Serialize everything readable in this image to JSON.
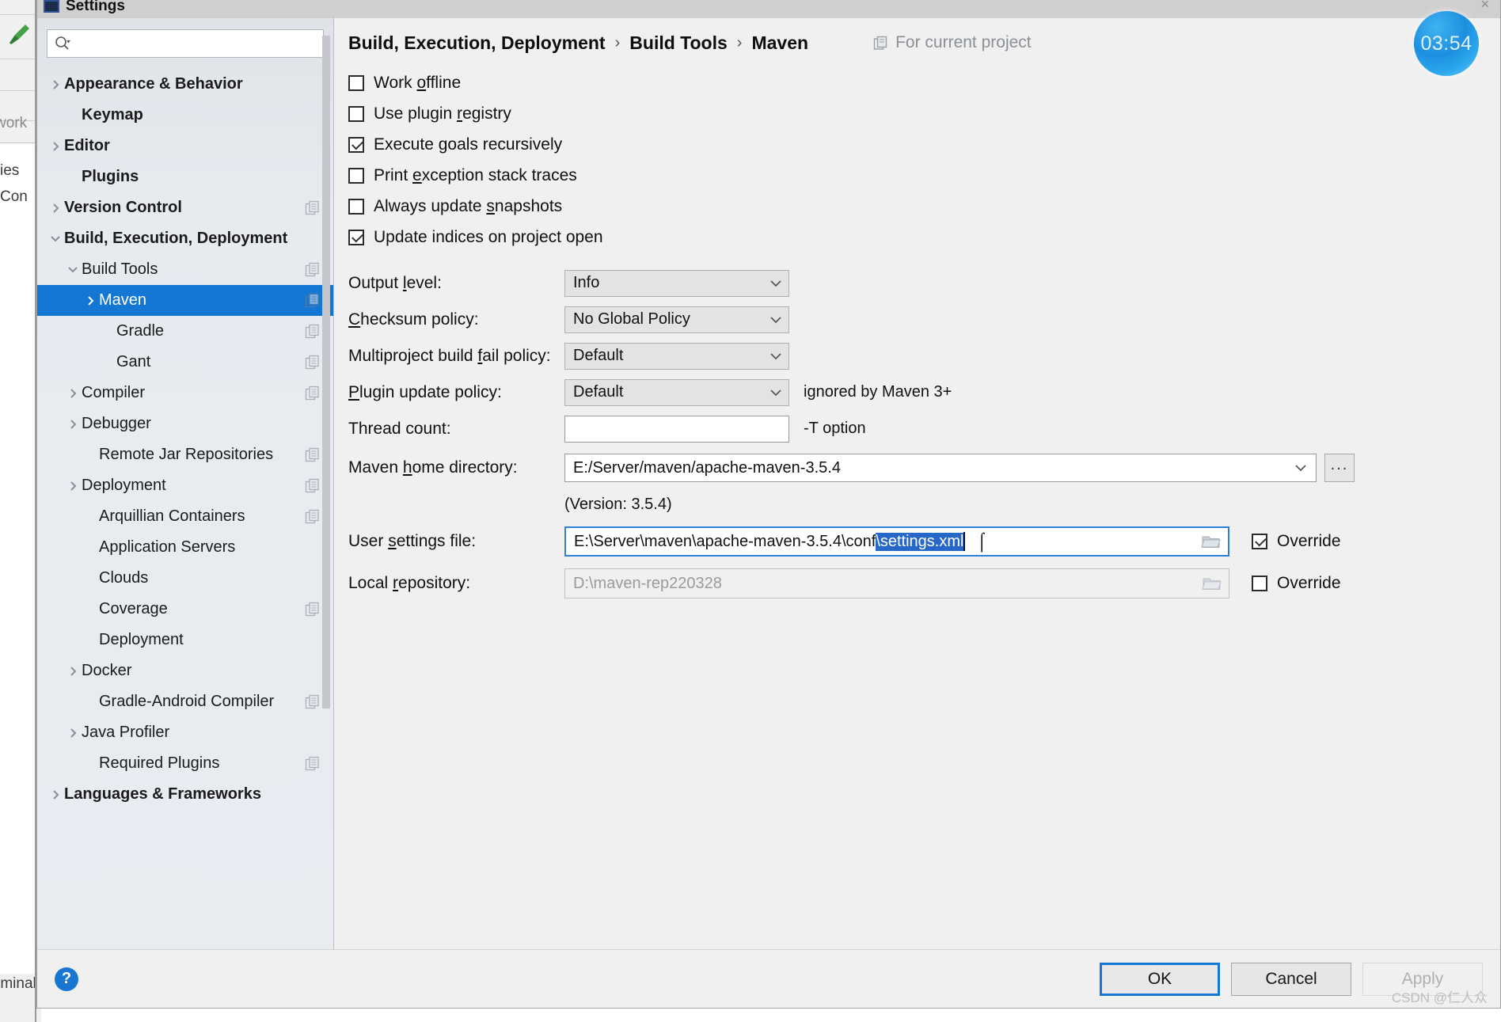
{
  "window": {
    "title": "Settings",
    "close_label": "×",
    "app_icon": "settings-window-icon"
  },
  "background": {
    "hammer_icon": "maven-hammer-icon",
    "text_fragments": [
      "work",
      "ies",
      "Con",
      "rminal"
    ]
  },
  "clock_widget": {
    "time": "03:54"
  },
  "search": {
    "value": "",
    "placeholder": "",
    "icon": "search-icon"
  },
  "sidebar": {
    "items": [
      {
        "label": "Appearance & Behavior",
        "indent": 0,
        "arrow": "right",
        "bold": true,
        "badge": false,
        "selected": false
      },
      {
        "label": "Keymap",
        "indent": 1,
        "arrow": "none",
        "bold": true,
        "badge": false,
        "selected": false
      },
      {
        "label": "Editor",
        "indent": 0,
        "arrow": "right",
        "bold": true,
        "badge": false,
        "selected": false
      },
      {
        "label": "Plugins",
        "indent": 1,
        "arrow": "none",
        "bold": true,
        "badge": false,
        "selected": false
      },
      {
        "label": "Version Control",
        "indent": 0,
        "arrow": "right",
        "bold": true,
        "badge": true,
        "selected": false
      },
      {
        "label": "Build, Execution, Deployment",
        "indent": 0,
        "arrow": "down",
        "bold": true,
        "badge": false,
        "selected": false
      },
      {
        "label": "Build Tools",
        "indent": 1,
        "arrow": "down",
        "bold": false,
        "badge": true,
        "selected": false
      },
      {
        "label": "Maven",
        "indent": 2,
        "arrow": "right",
        "bold": false,
        "badge": true,
        "selected": true
      },
      {
        "label": "Gradle",
        "indent": 3,
        "arrow": "none",
        "bold": false,
        "badge": true,
        "selected": false
      },
      {
        "label": "Gant",
        "indent": 3,
        "arrow": "none",
        "bold": false,
        "badge": true,
        "selected": false
      },
      {
        "label": "Compiler",
        "indent": 1,
        "arrow": "right",
        "bold": false,
        "badge": true,
        "selected": false
      },
      {
        "label": "Debugger",
        "indent": 1,
        "arrow": "right",
        "bold": false,
        "badge": false,
        "selected": false
      },
      {
        "label": "Remote Jar Repositories",
        "indent": 2,
        "arrow": "none",
        "bold": false,
        "badge": true,
        "selected": false
      },
      {
        "label": "Deployment",
        "indent": 1,
        "arrow": "right",
        "bold": false,
        "badge": true,
        "selected": false
      },
      {
        "label": "Arquillian Containers",
        "indent": 2,
        "arrow": "none",
        "bold": false,
        "badge": true,
        "selected": false
      },
      {
        "label": "Application Servers",
        "indent": 2,
        "arrow": "none",
        "bold": false,
        "badge": false,
        "selected": false
      },
      {
        "label": "Clouds",
        "indent": 2,
        "arrow": "none",
        "bold": false,
        "badge": false,
        "selected": false
      },
      {
        "label": "Coverage",
        "indent": 2,
        "arrow": "none",
        "bold": false,
        "badge": true,
        "selected": false
      },
      {
        "label": "Deployment",
        "indent": 2,
        "arrow": "none",
        "bold": false,
        "badge": false,
        "selected": false
      },
      {
        "label": "Docker",
        "indent": 1,
        "arrow": "right",
        "bold": false,
        "badge": false,
        "selected": false
      },
      {
        "label": "Gradle-Android Compiler",
        "indent": 2,
        "arrow": "none",
        "bold": false,
        "badge": true,
        "selected": false
      },
      {
        "label": "Java Profiler",
        "indent": 1,
        "arrow": "right",
        "bold": false,
        "badge": false,
        "selected": false
      },
      {
        "label": "Required Plugins",
        "indent": 2,
        "arrow": "none",
        "bold": false,
        "badge": true,
        "selected": false
      },
      {
        "label": "Languages & Frameworks",
        "indent": 0,
        "arrow": "right",
        "bold": true,
        "badge": false,
        "selected": false
      }
    ]
  },
  "breadcrumb": {
    "parts": [
      "Build, Execution, Deployment",
      "Build Tools",
      "Maven"
    ],
    "separator": "›",
    "scope_label": "For current project",
    "scope_icon": "project-scope-icon"
  },
  "main": {
    "checkboxes": [
      {
        "pre": "Work ",
        "mnemonic": "o",
        "post": "ffline",
        "checked": false
      },
      {
        "pre": "Use plugin ",
        "mnemonic": "r",
        "post": "egistry",
        "checked": false
      },
      {
        "pre": "Execute ",
        "mnemonic": "g",
        "post": "oals recursively",
        "checked": true
      },
      {
        "pre": "Print ",
        "mnemonic": "e",
        "post": "xception stack traces",
        "checked": false
      },
      {
        "pre": "Always update ",
        "mnemonic": "s",
        "post": "napshots",
        "checked": false
      },
      {
        "pre": "Update indices on project open",
        "mnemonic": "",
        "post": "",
        "checked": true
      }
    ],
    "fields": {
      "output_level": {
        "pre": "Output ",
        "mnemonic": "l",
        "post": "evel:",
        "value": "Info"
      },
      "checksum_policy": {
        "pre": "",
        "mnemonic": "C",
        "post": "hecksum policy:",
        "value": "No Global Policy"
      },
      "multiproject_fail": {
        "pre": "Multiproject build ",
        "mnemonic": "f",
        "post": "ail policy:",
        "value": "Default"
      },
      "plugin_update": {
        "pre": "",
        "mnemonic": "P",
        "post": "lugin update policy:",
        "value": "Default",
        "hint": "ignored by Maven 3+"
      },
      "thread_count": {
        "pre": "Thread count:",
        "mnemonic": "",
        "post": "",
        "value": "",
        "hint": "-T option"
      },
      "maven_home": {
        "pre": "Maven ",
        "mnemonic": "h",
        "post": "ome directory:",
        "value": "E:/Server/maven/apache-maven-3.5.4",
        "browse_label": "..."
      },
      "version_note": "(Version: 3.5.4)",
      "user_settings": {
        "pre": "User ",
        "mnemonic": "s",
        "post": "ettings file:",
        "value_plain": "E:\\Server\\maven\\apache-maven-3.5.4\\conf",
        "value_selected": "\\settings.xml",
        "override_label": "Override",
        "override_checked": true
      },
      "local_repository": {
        "pre": "Local ",
        "mnemonic": "r",
        "post": "epository:",
        "value": "D:\\maven-rep220328",
        "override_label": "Override",
        "override_checked": false
      }
    }
  },
  "footer": {
    "help_label": "?",
    "ok_label": "OK",
    "cancel_label": "Cancel",
    "apply_label": "Apply",
    "watermark": "CSDN @仁人众"
  },
  "colors": {
    "selection_blue": "#1477d4",
    "text_selection": "#2667c8",
    "focus_border": "#2e7fd6",
    "sidebar_bg": "#e7eaef"
  }
}
